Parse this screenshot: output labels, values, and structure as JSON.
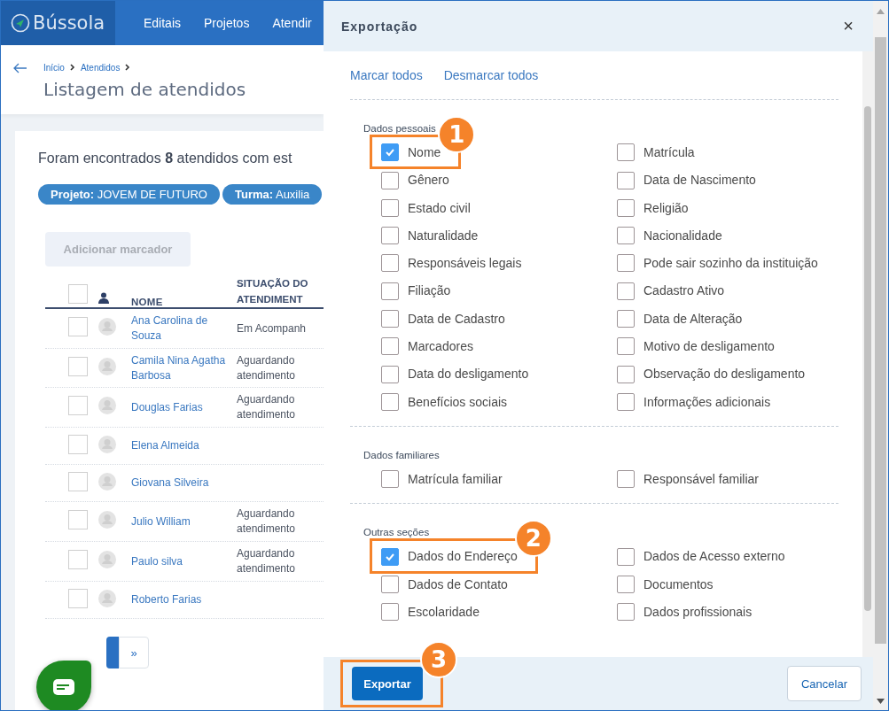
{
  "nav": {
    "logo": "Bússola",
    "items": [
      "Editais",
      "Projetos",
      "Atendir"
    ]
  },
  "breadcrumb": [
    "Início",
    "Atendidos"
  ],
  "page_title": "Listagem de atendidos",
  "summary": "Foram encontrados **8** atendidos com est",
  "filters": [
    "**Projeto:** JOVEM DE FUTURO",
    "**Turma:** Auxilia"
  ],
  "add_marker_button": {
    "label": "Adicionar marcador",
    "disabled": true
  },
  "table": {
    "select_all_checked": false,
    "columns": [
      "NOME",
      "SITUAÇÃO DO ATENDIMENT"
    ],
    "rows": [
      {
        "name": "Ana Carolina de Souza",
        "status": "Em Acompanh",
        "checked": false
      },
      {
        "name": "Camila Nina Agatha Barbosa",
        "status": "Aguardando atendimento",
        "checked": false
      },
      {
        "name": "Douglas Farias",
        "status": "Aguardando atendimento",
        "checked": false
      },
      {
        "name": "Elena Almeida",
        "checked": false
      },
      {
        "name": "Giovana Silveira",
        "checked": false
      },
      {
        "name": "Julio William",
        "status": "Aguardando atendimento",
        "checked": false
      },
      {
        "name": "Paulo silva",
        "status": "Aguardando atendimento",
        "checked": false
      },
      {
        "name": "Roberto Farias",
        "checked": false
      }
    ]
  },
  "pagination": {
    "next": "»"
  },
  "modal": {
    "title": "Exportação",
    "close": "×",
    "actions": [
      "Marcar todos",
      "Desmarcar todos"
    ],
    "sections": [
      {
        "title": "Dados pessoais",
        "items": [
          {
            "label": "Nome",
            "checked": true,
            "callout": "1"
          },
          {
            "label": "Matrícula",
            "checked": false
          },
          {
            "label": "Gênero",
            "checked": false
          },
          {
            "label": "Data de Nascimento",
            "checked": false
          },
          {
            "label": "Estado civil",
            "checked": false
          },
          {
            "label": "Religião",
            "checked": false
          },
          {
            "label": "Naturalidade",
            "checked": false
          },
          {
            "label": "Nacionalidade",
            "checked": false
          },
          {
            "label": "Responsáveis legais",
            "checked": false
          },
          {
            "label": "Pode sair sozinho da instituição",
            "checked": false
          },
          {
            "label": "Filiação",
            "checked": false
          },
          {
            "label": "Cadastro Ativo",
            "checked": false
          },
          {
            "label": "Data de Cadastro",
            "checked": false
          },
          {
            "label": "Data de Alteração",
            "checked": false
          },
          {
            "label": "Marcadores",
            "checked": false
          },
          {
            "label": "Motivo de desligamento",
            "checked": false
          },
          {
            "label": "Data do desligamento",
            "checked": false
          },
          {
            "label": "Observação do desligamento",
            "checked": false
          },
          {
            "label": "Benefícios sociais",
            "checked": false
          },
          {
            "label": "Informações adicionais",
            "checked": false
          }
        ]
      },
      {
        "title": "Dados familiares",
        "items": [
          {
            "label": "Matrícula familiar",
            "checked": false
          },
          {
            "label": "Responsável familiar",
            "checked": false
          }
        ]
      },
      {
        "title": "Outras seções",
        "items": [
          {
            "label": "Dados do Endereço",
            "checked": true,
            "callout": "2"
          },
          {
            "label": "Dados de Acesso externo",
            "checked": false
          },
          {
            "label": "Dados de Contato",
            "checked": false
          },
          {
            "label": "Documentos",
            "checked": false
          },
          {
            "label": "Escolaridade",
            "checked": false
          },
          {
            "label": "Dados profissionais",
            "checked": false
          }
        ]
      }
    ],
    "footer": {
      "primary": {
        "label": "Exportar",
        "callout": "3"
      },
      "secondary": {
        "label": "Cancelar"
      }
    }
  }
}
